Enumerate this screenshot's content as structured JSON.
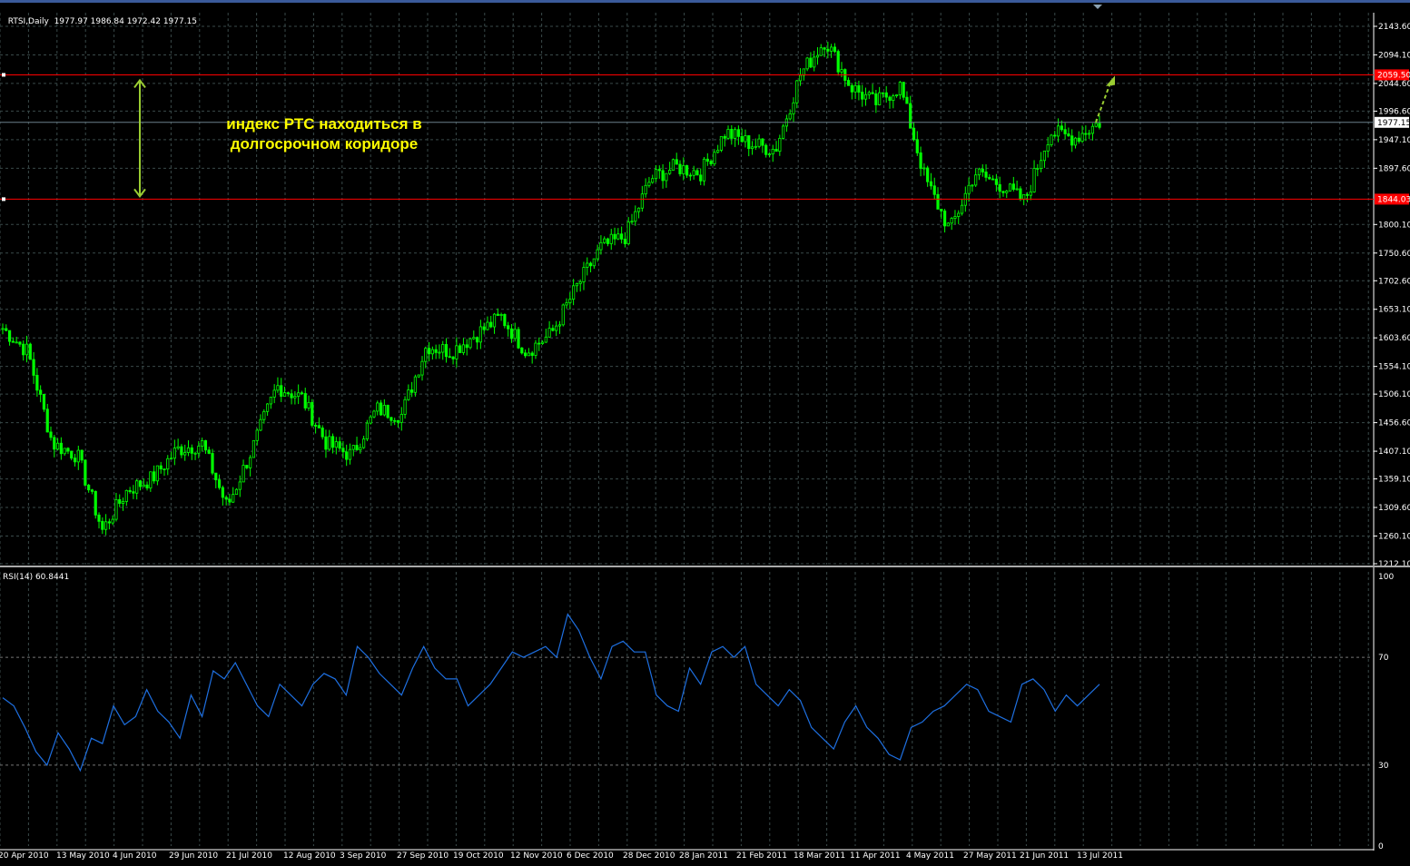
{
  "header": {
    "symbol": "RTSI,Daily",
    "ohlc": "1977.97 1986.84 1972.42 1977.15"
  },
  "indicator": {
    "label": "RSI(14) 60.8441"
  },
  "annotation": {
    "line1": "индекс РТС находиться в",
    "line2": "долгосрочном коридоре"
  },
  "colors": {
    "background": "#000000",
    "candle": "#00ff00",
    "grid": "#3a4a4a",
    "level_line": "#ff0000",
    "current_line": "#6a7f8a",
    "rsi_line": "#1e6fe0",
    "annotation": "#ffff00",
    "arrow": "#9acd32"
  },
  "chart_data": [
    {
      "type": "candlestick",
      "symbol": "RTSI",
      "timeframe": "Daily",
      "y_ticks": [
        "2143.60",
        "2094.10",
        "2044.60",
        "1996.60",
        "1947.10",
        "1897.60",
        "1800.10",
        "1750.60",
        "1702.60",
        "1653.10",
        "1603.60",
        "1554.10",
        "1506.10",
        "1456.60",
        "1407.10",
        "1359.10",
        "1309.60",
        "1260.10",
        "1212.10"
      ],
      "x_ticks": [
        "20 Apr 2010",
        "13 May 2010",
        "4 Jun 2010",
        "29 Jun 2010",
        "21 Jul 2010",
        "12 Aug 2010",
        "3 Sep 2010",
        "27 Sep 2010",
        "19 Oct 2010",
        "12 Nov 2010",
        "6 Dec 2010",
        "28 Dec 2010",
        "28 Jan 2011",
        "21 Feb 2011",
        "18 Mar 2011",
        "11 Apr 2011",
        "4 May 2011",
        "27 May 2011",
        "21 Jun 2011",
        "13 Jul 2011"
      ],
      "ylim": [
        1212.1,
        2143.6
      ],
      "current_price": "1977.15",
      "levels": [
        {
          "label": "2059.50",
          "value": 2059.5
        },
        {
          "label": "1844.03",
          "value": 1844.03
        }
      ],
      "close_path": [
        [
          "20 Apr 2010",
          1620
        ],
        [
          "30 Apr 2010",
          1580
        ],
        [
          "10 May 2010",
          1420
        ],
        [
          "13 May 2010",
          1400
        ],
        [
          "20 May 2010",
          1270
        ],
        [
          "25 May 2010",
          1340
        ],
        [
          "4 Jun 2010",
          1360
        ],
        [
          "10 Jun 2010",
          1410
        ],
        [
          "18 Jun 2010",
          1420
        ],
        [
          "29 Jun 2010",
          1310
        ],
        [
          "8 Jul 2010",
          1410
        ],
        [
          "21 Jul 2010",
          1520
        ],
        [
          "30 Jul 2010",
          1500
        ],
        [
          "12 Aug 2010",
          1420
        ],
        [
          "20 Aug 2010",
          1400
        ],
        [
          "3 Sep 2010",
          1480
        ],
        [
          "15 Sep 2010",
          1470
        ],
        [
          "27 Sep 2010",
          1590
        ],
        [
          "8 Oct 2010",
          1580
        ],
        [
          "19 Oct 2010",
          1610
        ],
        [
          "29 Oct 2010",
          1640
        ],
        [
          "5 Nov 2010",
          1580
        ],
        [
          "12 Nov 2010",
          1610
        ],
        [
          "22 Nov 2010",
          1690
        ],
        [
          "6 Dec 2010",
          1760
        ],
        [
          "20 Dec 2010",
          1780
        ],
        [
          "28 Dec 2010",
          1880
        ],
        [
          "10 Jan 2011",
          1900
        ],
        [
          "28 Jan 2011",
          1890
        ],
        [
          "10 Feb 2011",
          1960
        ],
        [
          "21 Feb 2011",
          1940
        ],
        [
          "5 Mar 2011",
          1930
        ],
        [
          "18 Mar 2011",
          2060
        ],
        [
          "24 Mar 2011",
          2120
        ],
        [
          "4 Apr 2011",
          2040
        ],
        [
          "11 Apr 2011",
          2010
        ],
        [
          "20 Apr 2011",
          2040
        ],
        [
          "4 May 2011",
          1880
        ],
        [
          "16 May 2011",
          1790
        ],
        [
          "27 May 2011",
          1890
        ],
        [
          "7 Jun 2011",
          1870
        ],
        [
          "21 Jun 2011",
          1840
        ],
        [
          "1 Jul 2011",
          1960
        ],
        [
          "13 Jul 2011",
          1950
        ],
        [
          "18 Jul 2011",
          1977
        ]
      ]
    },
    {
      "type": "line",
      "name": "RSI(14) 60.8441",
      "y_ticks": [
        "100",
        "70",
        "30",
        "0"
      ],
      "ylim": [
        0,
        100
      ],
      "levels": [
        70,
        30
      ],
      "last_value": 60.8441,
      "values": [
        55,
        52,
        44,
        35,
        30,
        42,
        36,
        28,
        40,
        38,
        52,
        45,
        48,
        58,
        50,
        46,
        40,
        56,
        48,
        65,
        62,
        68,
        60,
        52,
        48,
        60,
        56,
        52,
        60,
        64,
        62,
        56,
        74,
        70,
        64,
        60,
        56,
        66,
        74,
        66,
        62,
        62,
        52,
        56,
        60,
        66,
        72,
        70,
        72,
        74,
        70,
        86,
        80,
        70,
        62,
        74,
        76,
        72,
        72,
        56,
        52,
        50,
        66,
        60,
        72,
        74,
        70,
        74,
        60,
        56,
        52,
        58,
        54,
        44,
        40,
        36,
        46,
        52,
        44,
        40,
        34,
        32,
        44,
        46,
        50,
        52,
        56,
        60,
        58,
        50,
        48,
        46,
        60,
        62,
        58,
        50,
        56,
        52,
        56,
        60
      ]
    }
  ]
}
